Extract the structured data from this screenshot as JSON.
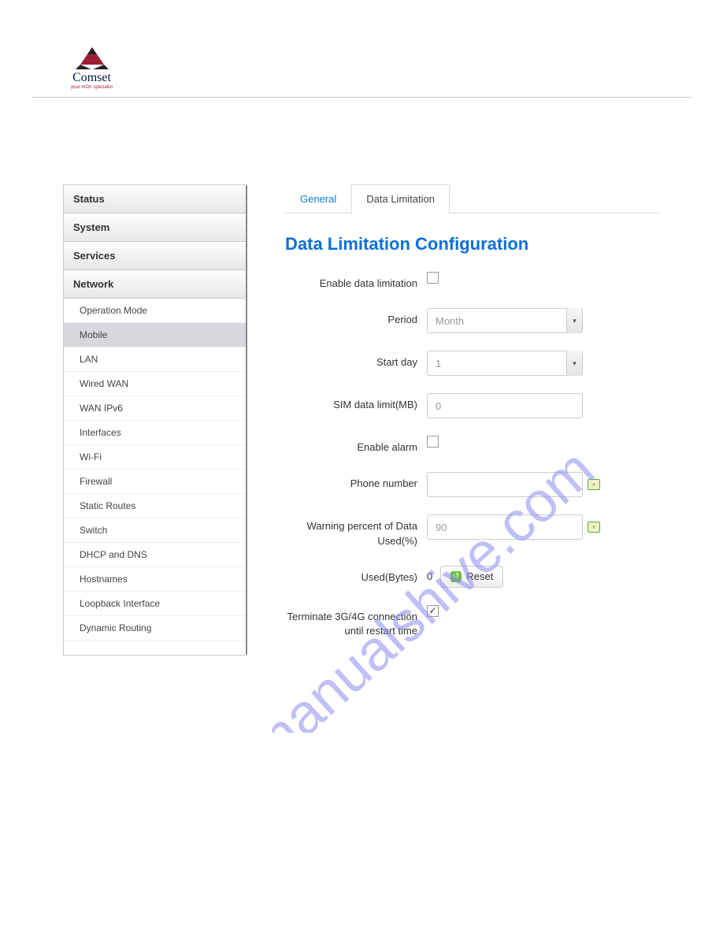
{
  "brand": {
    "name": "Comset",
    "tagline": "your m2m specialist"
  },
  "watermark": "manualshive.com",
  "sidebar": {
    "groups": [
      {
        "label": "Status"
      },
      {
        "label": "System"
      },
      {
        "label": "Services"
      },
      {
        "label": "Network"
      }
    ],
    "items": [
      "Operation Mode",
      "Mobile",
      "LAN",
      "Wired WAN",
      "WAN IPv6",
      "Interfaces",
      "Wi-Fi",
      "Firewall",
      "Static Routes",
      "Switch",
      "DHCP and DNS",
      "Hostnames",
      "Loopback Interface",
      "Dynamic Routing"
    ],
    "active_item": "Mobile"
  },
  "tabs": {
    "items": [
      "General",
      "Data Limitation"
    ],
    "active": "Data Limitation"
  },
  "title": "Data Limitation Configuration",
  "form": {
    "enable_data_limitation": {
      "label": "Enable data limitation",
      "checked": false
    },
    "period": {
      "label": "Period",
      "value": "Month"
    },
    "start_day": {
      "label": "Start day",
      "value": "1"
    },
    "sim_data_limit": {
      "label": "SIM data limit(MB)",
      "value": "0"
    },
    "enable_alarm": {
      "label": "Enable alarm",
      "checked": false
    },
    "phone_number": {
      "label": "Phone number",
      "value": ""
    },
    "warning_percent": {
      "label": "Warning percent of Data Used(%)",
      "value": "90"
    },
    "used": {
      "label": "Used(Bytes)",
      "value": "0",
      "reset_label": "Reset"
    },
    "terminate": {
      "label": "Terminate 3G/4G connection until restart time",
      "checked": true
    }
  }
}
